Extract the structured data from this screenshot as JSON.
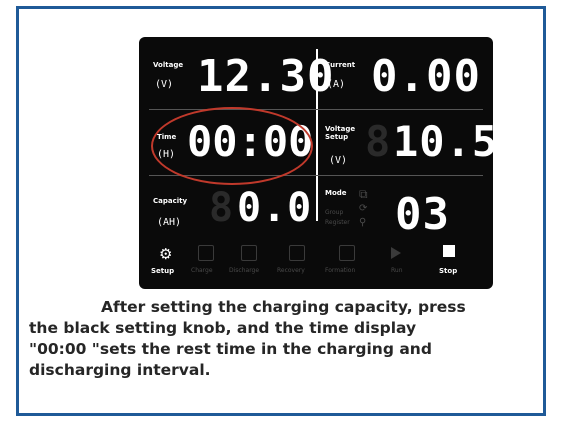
{
  "lcd": {
    "voltage": {
      "label": "Voltage",
      "unit": "(V)",
      "value": "12.30"
    },
    "current": {
      "label": "Current",
      "unit": "(A)",
      "value": "0.00"
    },
    "time": {
      "label": "Time",
      "unit": "(H)",
      "value": "00:00"
    },
    "voltage_setup": {
      "label1": "Voltage",
      "label2": "Setup",
      "unit": "(V)",
      "value": "10.5"
    },
    "capacity": {
      "label": "Capacity",
      "unit": "(AH)",
      "value": "0.0"
    },
    "mode": {
      "label": "Mode",
      "sub1": "Group",
      "sub2": "Register",
      "value": "03"
    },
    "bottom": {
      "setup": "Setup",
      "charge": "Charge",
      "discharge": "Discharge",
      "recovery": "Recovery",
      "formation": "Formation",
      "run": "Run",
      "stop": "Stop"
    }
  },
  "caption": {
    "line1": "After setting the charging capacity, press",
    "line2": "the black setting knob, and the time display",
    "line3": "\"00:00 \"sets the rest time in the charging and",
    "line4": "discharging interval."
  },
  "colors": {
    "frame": "#1f5a98",
    "highlight": "#c0392b",
    "lcd": "#0a0a0a"
  }
}
